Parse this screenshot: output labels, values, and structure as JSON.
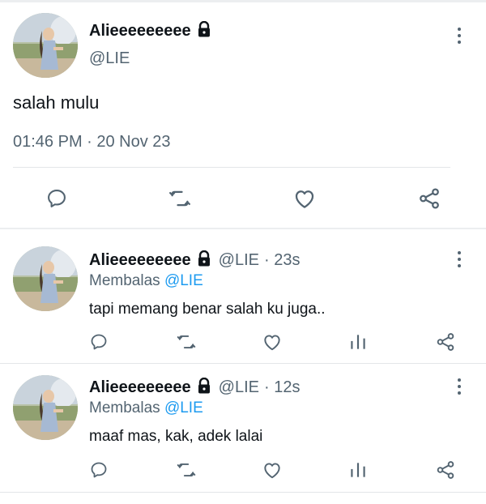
{
  "main_tweet": {
    "display_name": "Alieeeeeeeee",
    "handle": "@LIE",
    "text": "salah mulu",
    "timestamp": "01:46 PM · 20 Nov 23",
    "icons": {
      "lock": "lock-icon",
      "more": "more-vertical-icon",
      "reply": "reply-icon",
      "retweet": "retweet-icon",
      "like": "heart-icon",
      "share": "share-icon"
    }
  },
  "replies": [
    {
      "display_name": "Alieeeeeeeee",
      "handle": "@LIE",
      "time": "· 23s",
      "replying_prefix": "Membalas",
      "replying_to": "@LIE",
      "text": "tapi memang benar salah ku juga.."
    },
    {
      "display_name": "Alieeeeeeeee",
      "handle": "@LIE",
      "time": "· 12s",
      "replying_prefix": "Membalas",
      "replying_to": "@LIE",
      "text": "maaf mas, kak, adek lalai"
    }
  ],
  "colors": {
    "text": "#0f1419",
    "secondary": "#536471",
    "accent": "#1d9bf0",
    "divider": "#e3e6e8"
  }
}
